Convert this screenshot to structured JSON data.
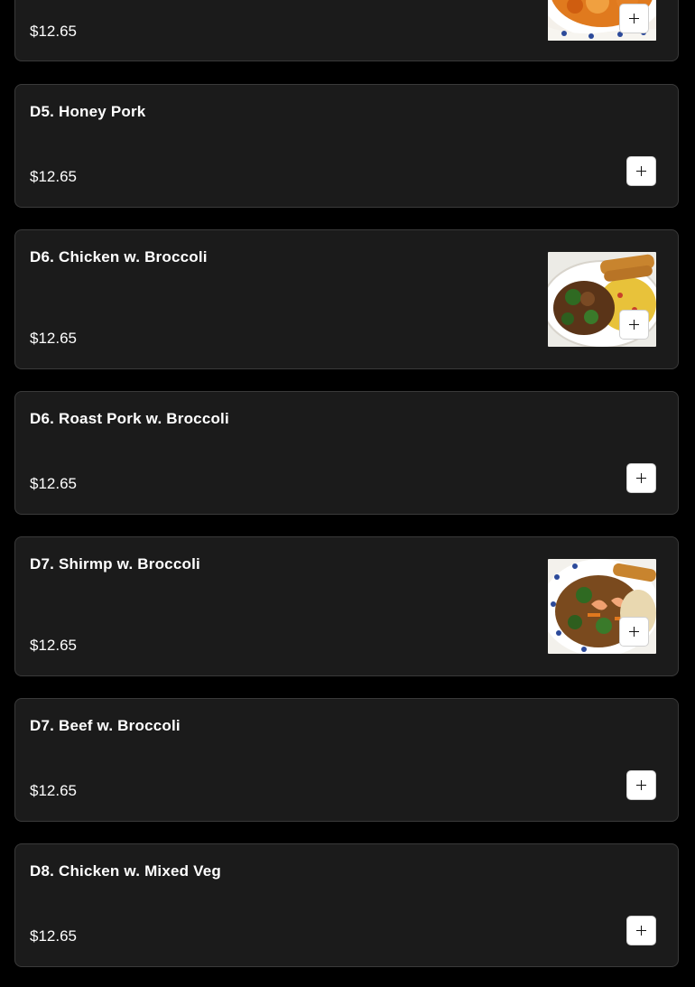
{
  "items": [
    {
      "name": "",
      "price": "$12.65",
      "add_label": "Add item",
      "has_image": true
    },
    {
      "name": "D5. Honey Pork",
      "price": "$12.65",
      "add_label": "Add item",
      "has_image": false
    },
    {
      "name": "D6. Chicken w. Broccoli",
      "price": "$12.65",
      "add_label": "Add item",
      "has_image": true
    },
    {
      "name": "D6. Roast Pork w. Broccoli",
      "price": "$12.65",
      "add_label": "Add item",
      "has_image": false
    },
    {
      "name": "D7. Shirmp w. Broccoli",
      "price": "$12.65",
      "add_label": "Add item",
      "has_image": true
    },
    {
      "name": "D7. Beef w. Broccoli",
      "price": "$12.65",
      "add_label": "Add item",
      "has_image": false
    },
    {
      "name": "D8. Chicken w. Mixed Veg",
      "price": "$12.65",
      "add_label": "Add item",
      "has_image": false
    }
  ],
  "colors": {
    "page_bg": "#000000",
    "card_bg": "#1b1b1b",
    "card_border": "#3a3a3a",
    "text": "#ffffff",
    "button_bg": "#ffffff"
  }
}
